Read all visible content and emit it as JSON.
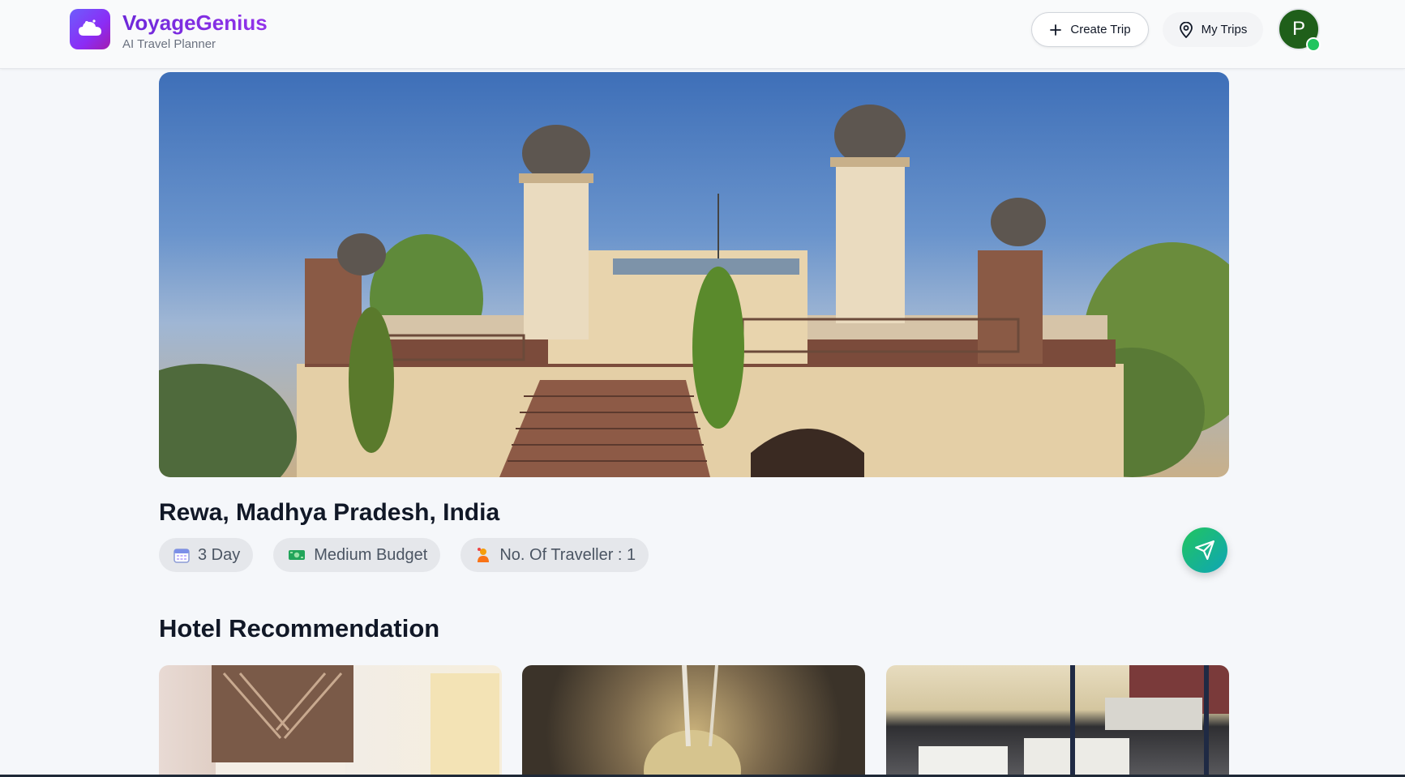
{
  "header": {
    "brand_name": "VoyageGenius",
    "brand_subtitle": "AI Travel Planner",
    "create_trip_label": "Create Trip",
    "my_trips_label": "My Trips",
    "avatar_initial": "P"
  },
  "trip": {
    "destination": "Rewa, Madhya Pradesh, India",
    "duration": "3 Day",
    "budget": "Medium Budget",
    "travellers": "No. Of Traveller : 1"
  },
  "hotels": {
    "section_title": "Hotel Recommendation"
  },
  "icons": {
    "logo": "cloud-logo-icon",
    "create_trip": "plus-icon",
    "my_trips": "map-pin-icon",
    "duration": "calendar-icon",
    "budget": "money-icon",
    "travellers": "traveller-icon",
    "share": "send-icon"
  },
  "colors": {
    "brand": "#7c3aed",
    "share_start": "#22c55e",
    "share_end": "#0ea5b7",
    "online": "#22c55e",
    "avatar_bg": "#1f5f1a"
  }
}
